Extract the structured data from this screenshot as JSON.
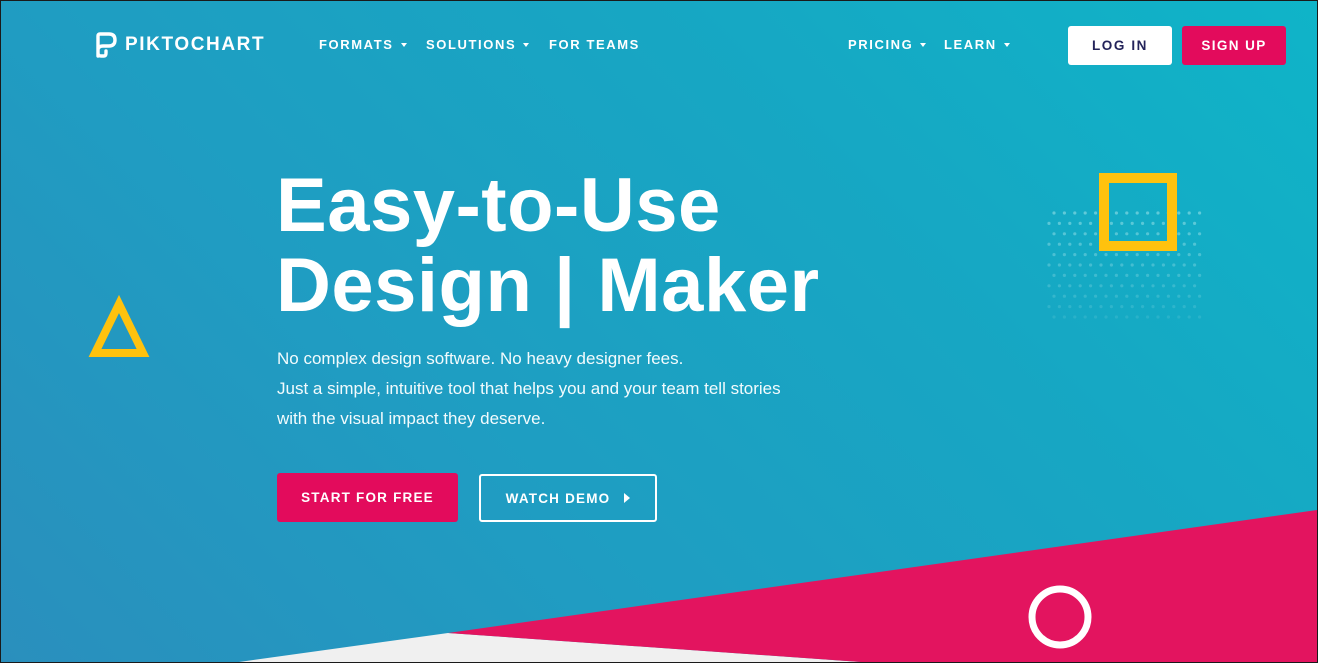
{
  "header": {
    "brand": "PIKTOCHART",
    "logo_icon": "piktochart-logo-icon",
    "nav_left": [
      {
        "label": "FORMATS",
        "has_dropdown": true
      },
      {
        "label": "SOLUTIONS",
        "has_dropdown": true
      },
      {
        "label": "FOR TEAMS",
        "has_dropdown": false
      }
    ],
    "nav_right": [
      {
        "label": "PRICING",
        "has_dropdown": true
      },
      {
        "label": "LEARN",
        "has_dropdown": true
      }
    ],
    "login_label": "LOG IN",
    "signup_label": "SIGN UP"
  },
  "hero": {
    "headline_line1": "Easy-to-Use",
    "headline_line2": "Design | Maker",
    "subtext_lines": [
      "No complex design software. No heavy designer fees.",
      "Just a simple, intuitive tool that helps you and your team tell stories",
      "with the visual impact they deserve."
    ],
    "primary_cta": "START FOR FREE",
    "secondary_cta": "WATCH DEMO",
    "secondary_cta_icon": "play-icon"
  },
  "colors": {
    "brand_pink": "#e30b5c",
    "accent_yellow": "#ffc20e",
    "background_teal": "#17a6c3",
    "login_text": "#23235a",
    "footer_white": "#f0f0f0"
  }
}
